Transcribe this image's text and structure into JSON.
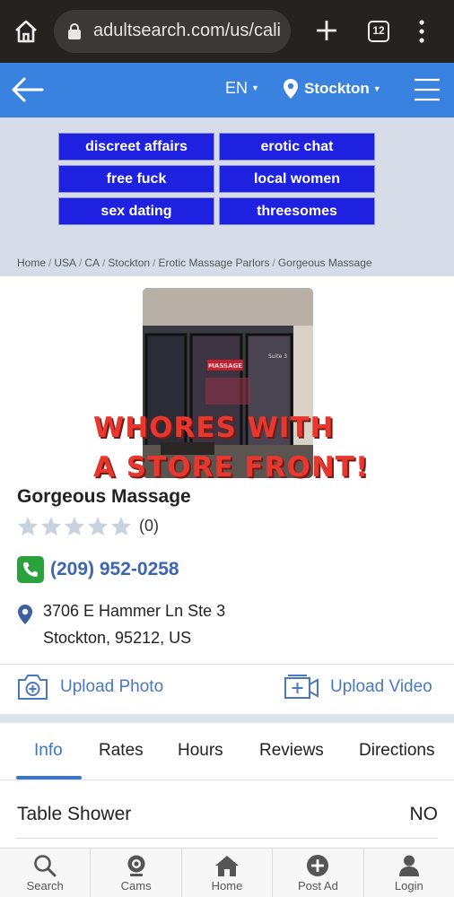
{
  "browser": {
    "url": "adultsearch.com/us/cali",
    "tab_count": "12",
    "icons": [
      "home-icon",
      "lock-icon",
      "plus-icon",
      "tab-switcher-icon",
      "kebab-menu-icon"
    ]
  },
  "header": {
    "language": "EN",
    "location": "Stockton",
    "colors": {
      "bar": "#3a82e0"
    }
  },
  "promo_buttons": [
    "discreet affairs",
    "erotic chat",
    "free fuck",
    "local women",
    "sex dating",
    "threesomes"
  ],
  "breadcrumb": [
    "Home",
    "USA",
    "CA",
    "Stockton",
    "Erotic Massage Parlors",
    "Gorgeous Massage"
  ],
  "photo": {
    "sign_text": "MASSAGE",
    "door_text": "Suite 3",
    "overlay_line1": "WHORES WITH",
    "overlay_line2": "A STORE FRONT!"
  },
  "business": {
    "name": "Gorgeous Massage",
    "rating_stars": 0,
    "review_count": "(0)",
    "phone": "(209) 952-0258",
    "address_line1": "3706 E Hammer Ln Ste 3",
    "address_line2": "Stockton, 95212, US"
  },
  "actions": {
    "upload_photo": "Upload Photo",
    "upload_video": "Upload Video"
  },
  "tabs": [
    "Info",
    "Rates",
    "Hours",
    "Reviews",
    "Directions"
  ],
  "active_tab": "Info",
  "info_rows": [
    {
      "label": "Table Shower",
      "value": "NO"
    }
  ],
  "bottom_nav": [
    "Search",
    "Cams",
    "Home",
    "Post Ad",
    "Login"
  ]
}
